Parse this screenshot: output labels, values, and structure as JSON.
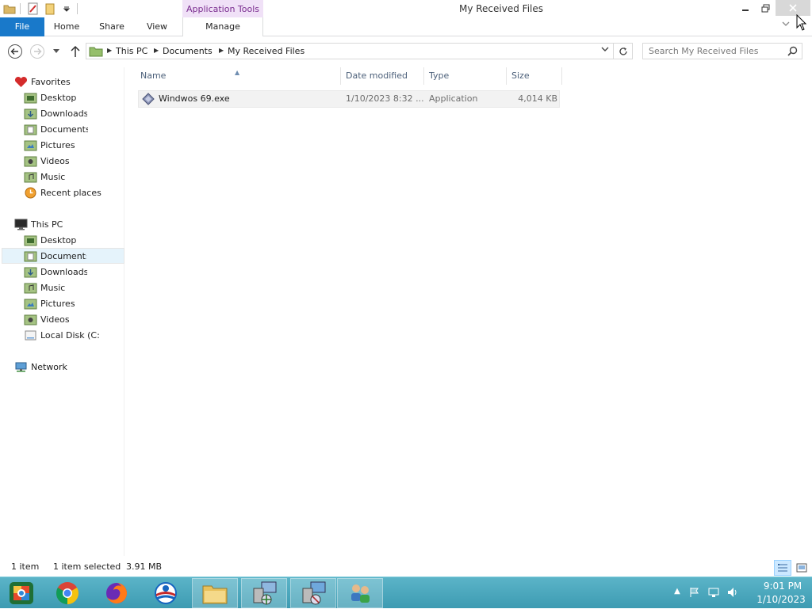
{
  "window": {
    "title": "My Received Files",
    "context_tab_header": "Application Tools"
  },
  "ribbon": {
    "tabs": [
      {
        "label": "File"
      },
      {
        "label": "Home"
      },
      {
        "label": "Share"
      },
      {
        "label": "View"
      },
      {
        "label": "Manage"
      }
    ]
  },
  "address": {
    "crumbs": [
      "This PC",
      "Documents",
      "My Received Files"
    ]
  },
  "search": {
    "placeholder": "Search My Received Files"
  },
  "navpane": {
    "favorites": {
      "label": "Favorites",
      "items": [
        "Desktop",
        "Downloads",
        "Documents",
        "Pictures",
        "Videos",
        "Music",
        "Recent places"
      ]
    },
    "this_pc": {
      "label": "This PC",
      "items": [
        "Desktop",
        "Documents",
        "Downloads",
        "Music",
        "Pictures",
        "Videos",
        "Local Disk (C:)"
      ],
      "selected": "Documents"
    },
    "network": {
      "label": "Network"
    }
  },
  "filelist": {
    "columns": [
      "Name",
      "Date modified",
      "Type",
      "Size"
    ],
    "sort_column": "Name",
    "rows": [
      {
        "name": "Windwos 69.exe",
        "date": "1/10/2023 8:32 ...",
        "type": "Application",
        "size": "4,014 KB",
        "selected": true
      }
    ]
  },
  "status": {
    "count": "1 item",
    "selected": "1 item selected",
    "size": "3.91 MB"
  },
  "taskbar": {
    "apps": [
      "start-orb-icon",
      "chrome-icon",
      "firefox-icon",
      "opera-icon",
      "file-explorer-icon",
      "network-computer-icon",
      "remote-desktop-icon",
      "users-icon"
    ],
    "clock_time": "9:01 PM",
    "clock_date": "1/10/2023"
  },
  "colors": {
    "file_tab": "#1979ca",
    "context_tab": "#f0e1f7",
    "context_tab_text": "#7a2d8f",
    "taskbar": "#4aa8bd",
    "selection": "#e5f3fb"
  }
}
